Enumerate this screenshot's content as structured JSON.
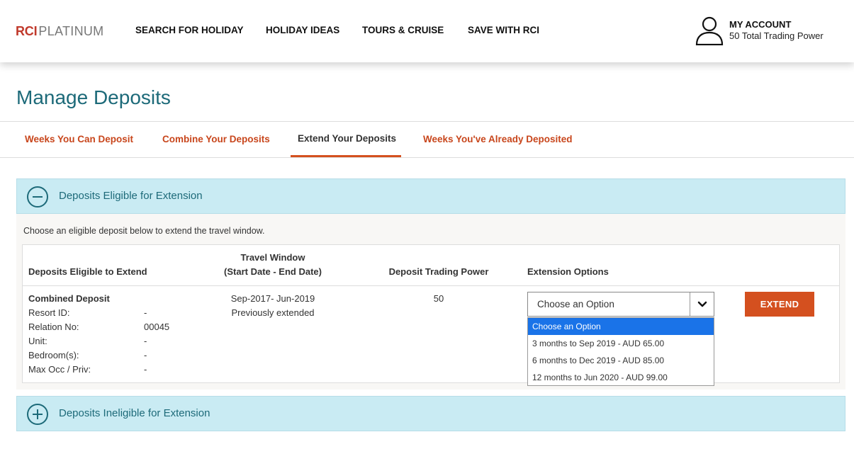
{
  "header": {
    "logo_rci": "RCI",
    "logo_platinum": "PLATINUM",
    "nav": [
      "SEARCH FOR HOLIDAY",
      "HOLIDAY IDEAS",
      "TOURS  & CRUISE",
      "SAVE WITH RCI"
    ],
    "account_title": "MY ACCOUNT",
    "account_sub": "50 Total Trading Power"
  },
  "page": {
    "title": "Manage Deposits",
    "tabs": [
      "Weeks You Can Deposit",
      "Combine Your Deposits",
      "Extend Your Deposits",
      "Weeks You've Already Deposited"
    ],
    "active_tab": "Extend Your Deposits"
  },
  "eligible": {
    "title": "Deposits Eligible for Extension",
    "description": "Choose an eligible deposit below to extend the travel window.",
    "columns": {
      "deposit": "Deposits Eligible to Extend",
      "window_line1": "Travel Window",
      "window_line2": "(Start Date - End Date)",
      "power": "Deposit Trading Power",
      "options": "Extension Options"
    },
    "row": {
      "name": "Combined Deposit",
      "fields": [
        {
          "label": "Resort ID:",
          "value": "-"
        },
        {
          "label": "Relation No:",
          "value": "00045"
        },
        {
          "label": "Unit:",
          "value": "-"
        },
        {
          "label": "Bedroom(s):",
          "value": "-"
        },
        {
          "label": "Max Occ / Priv:",
          "value": "-"
        }
      ],
      "window": "Sep-2017- Jun-2019",
      "window_note": "Previously extended",
      "power": "50",
      "select_value": "Choose an Option",
      "extend_label": "EXTEND"
    },
    "dropdown_options": [
      "Choose an Option",
      "3 months to Sep 2019 - AUD 65.00",
      "6 months to Dec 2019 - AUD 85.00",
      "12 months to Jun 2020 - AUD 99.00"
    ]
  },
  "ineligible": {
    "title": "Deposits Ineligible for Extension"
  },
  "colors": {
    "accent": "#d4501f",
    "teal": "#1d6a79",
    "panel": "#c9ebf3",
    "selected_option": "#1a73e8"
  },
  "icons": {
    "account": "user-icon",
    "collapse": "minus-circle-icon",
    "expand": "plus-circle-icon",
    "select": "chevron-down-icon"
  }
}
